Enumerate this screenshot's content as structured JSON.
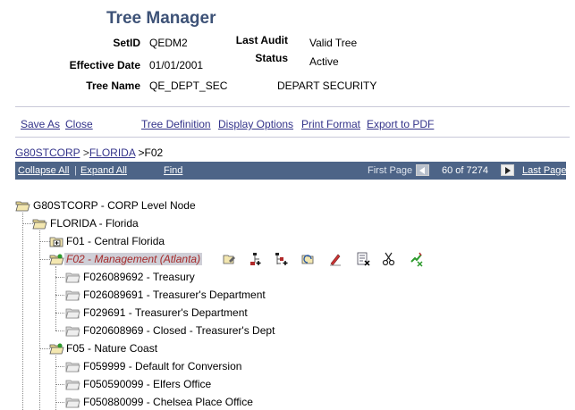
{
  "header": {
    "title": "Tree Manager",
    "setid_label": "SetID",
    "setid_value": "QEDM2",
    "last_audit_label": "Last Audit",
    "last_audit_value": "Valid Tree",
    "effective_date_label": "Effective Date",
    "effective_date_value": "01/01/2001",
    "status_label": "Status",
    "status_value": "Active",
    "tree_name_label": "Tree Name",
    "tree_name_value": "QE_DEPT_SEC",
    "tree_desc": "DEPART SECURITY"
  },
  "links": {
    "save_as": "Save As",
    "close": "Close",
    "tree_definition": "Tree Definition",
    "display_options": "Display Options",
    "print_format": "Print Format",
    "export_pdf": "Export to PDF"
  },
  "breadcrumb": {
    "root": "G80STCORP",
    "sep1": ">",
    "level1": "FLORIDA",
    "current": ">F02"
  },
  "navbar": {
    "collapse_all": "Collapse All",
    "sep": "|",
    "expand_all": "Expand All",
    "find": "Find",
    "first_page": "First Page",
    "page_info": "60 of 7274",
    "last_page": "Last Page"
  },
  "tree": {
    "root": "G80STCORP - CORP Level Node",
    "florida": "FLORIDA - Florida",
    "f01": "F01 - Central Florida",
    "f02": "F02 - Management (Atlanta)",
    "f02_children": [
      "F026089692 - Treasury",
      "F026089691 - Treasurer's Department",
      "F029691 - Treasurer's Department",
      "F020608969 - Closed - Treasurer's Dept"
    ],
    "f05": "F05 - Nature Coast",
    "f05_children": [
      "F059999 - Default for Conversion",
      "F050590099 - Elfers Office",
      "F050880099 - Chelsea Place Office"
    ]
  },
  "colors": {
    "title": "#3d5277",
    "navbar": "#4d6487",
    "link": "#33338a",
    "selected_text": "#a52a2a",
    "folder": "#f0e0a0"
  }
}
